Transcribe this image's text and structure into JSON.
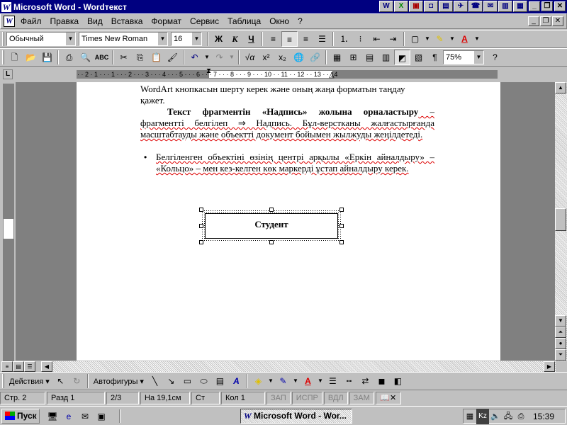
{
  "window": {
    "title": "Microsoft Word - Wordтекст"
  },
  "menubar": {
    "items": [
      "Файл",
      "Правка",
      "Вид",
      "Вставка",
      "Формат",
      "Сервис",
      "Таблица",
      "Окно",
      "?"
    ]
  },
  "format_toolbar": {
    "style_value": "Обычный",
    "font_value": "Times New Roman",
    "size_value": "16",
    "bold_label": "Ж",
    "italic_label": "К",
    "underline_label": "Ч"
  },
  "standard_toolbar": {
    "zoom_value": "75%"
  },
  "ruler": {
    "labels": "· · 2 · 1 · · · 1 · · · 2 · · · 3 · · · 4 · · · 5 · · · 6 · · · 7 · · · 8 · · · 9 · · · 10 · · 11 · · 12 · · 13 · · 14"
  },
  "document": {
    "para1_line1": "WordArt кнопкасын шерту керек және оның жаңа форматын таңдау",
    "para1_line2": "қажет.",
    "para2_bold": "Текст фрагментін «Надпись» жолына орналастыру",
    "para2_rest": " – фрагментті белгілеп ⇒ Надпись. Бұл-верстканы жалғастырғанда масштабтауды және объектті документ бойымен жылжуды жеңілдетеді.",
    "bullet_symbol": "•",
    "bullet_text": "Белгіленген объектіні өзінің центрі арқылы «Еркін айналдыру» – «Кольцо» – мен кез-келген көк маркерді ұстап айналдыру керек.",
    "textbox_text": "Студент"
  },
  "drawing_toolbar": {
    "actions_label": "Действия ▾",
    "autoshapes_label": "Автофигуры ▾"
  },
  "statusbar": {
    "page": "Стр. 2",
    "section": "Разд 1",
    "pages": "2/3",
    "position": "На 19,1см",
    "line": "Ст",
    "column": "Кол 1",
    "rec": "ЗАП",
    "trk": "ИСПР",
    "ext": "ВДЛ",
    "ovr": "ЗАМ"
  },
  "taskbar": {
    "start_label": "Пуск",
    "task_word": "Microsoft Word - Wor...",
    "clock": "15:39"
  }
}
